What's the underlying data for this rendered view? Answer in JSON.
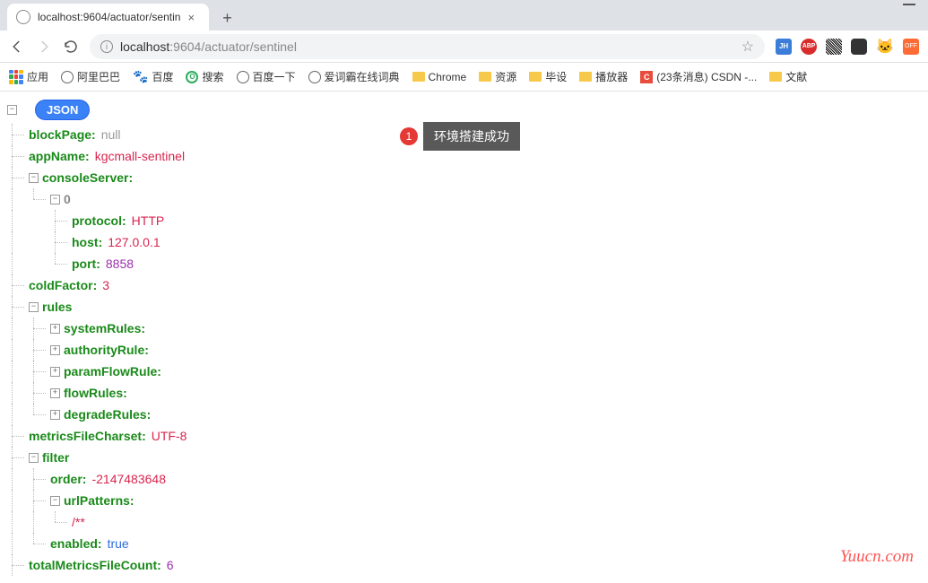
{
  "browser": {
    "tab_title": "localhost:9604/actuator/sentin",
    "url_host": "localhost",
    "url_port": ":9604",
    "url_path": "/actuator/sentinel"
  },
  "bookmarks": {
    "apps": "应用",
    "items": [
      "阿里巴巴",
      "百度",
      "搜索",
      "百度一下",
      "爱词霸在线词典",
      "Chrome",
      "资源",
      "毕设",
      "播放器",
      "(23条消息) CSDN -...",
      "文献"
    ]
  },
  "json_badge": "JSON",
  "tree": {
    "blockPage_k": "blockPage",
    "blockPage_v": "null",
    "appName_k": "appName",
    "appName_v": "kgcmall-sentinel",
    "consoleServer_k": "consoleServer",
    "idx0": "0",
    "protocol_k": "protocol",
    "protocol_v": "HTTP",
    "host_k": "host",
    "host_v": "127.0.0.1",
    "port_k": "port",
    "port_v": "8858",
    "coldFactor_k": "coldFactor",
    "coldFactor_v": "3",
    "rules_k": "rules",
    "systemRules_k": "systemRules",
    "authorityRule_k": "authorityRule",
    "paramFlowRule_k": "paramFlowRule",
    "flowRules_k": "flowRules",
    "degradeRules_k": "degradeRules",
    "metricsFileCharset_k": "metricsFileCharset",
    "metricsFileCharset_v": "UTF-8",
    "filter_k": "filter",
    "order_k": "order",
    "order_v": "-2147483648",
    "urlPatterns_k": "urlPatterns",
    "urlPatterns_0": "/**",
    "enabled_k": "enabled",
    "enabled_v": "true",
    "totalMetricsFileCount_k": "totalMetricsFileCount",
    "totalMetricsFileCount_v": "6"
  },
  "callout": {
    "num": "1",
    "text": "环境搭建成功"
  },
  "watermark": "Yuucn.com"
}
